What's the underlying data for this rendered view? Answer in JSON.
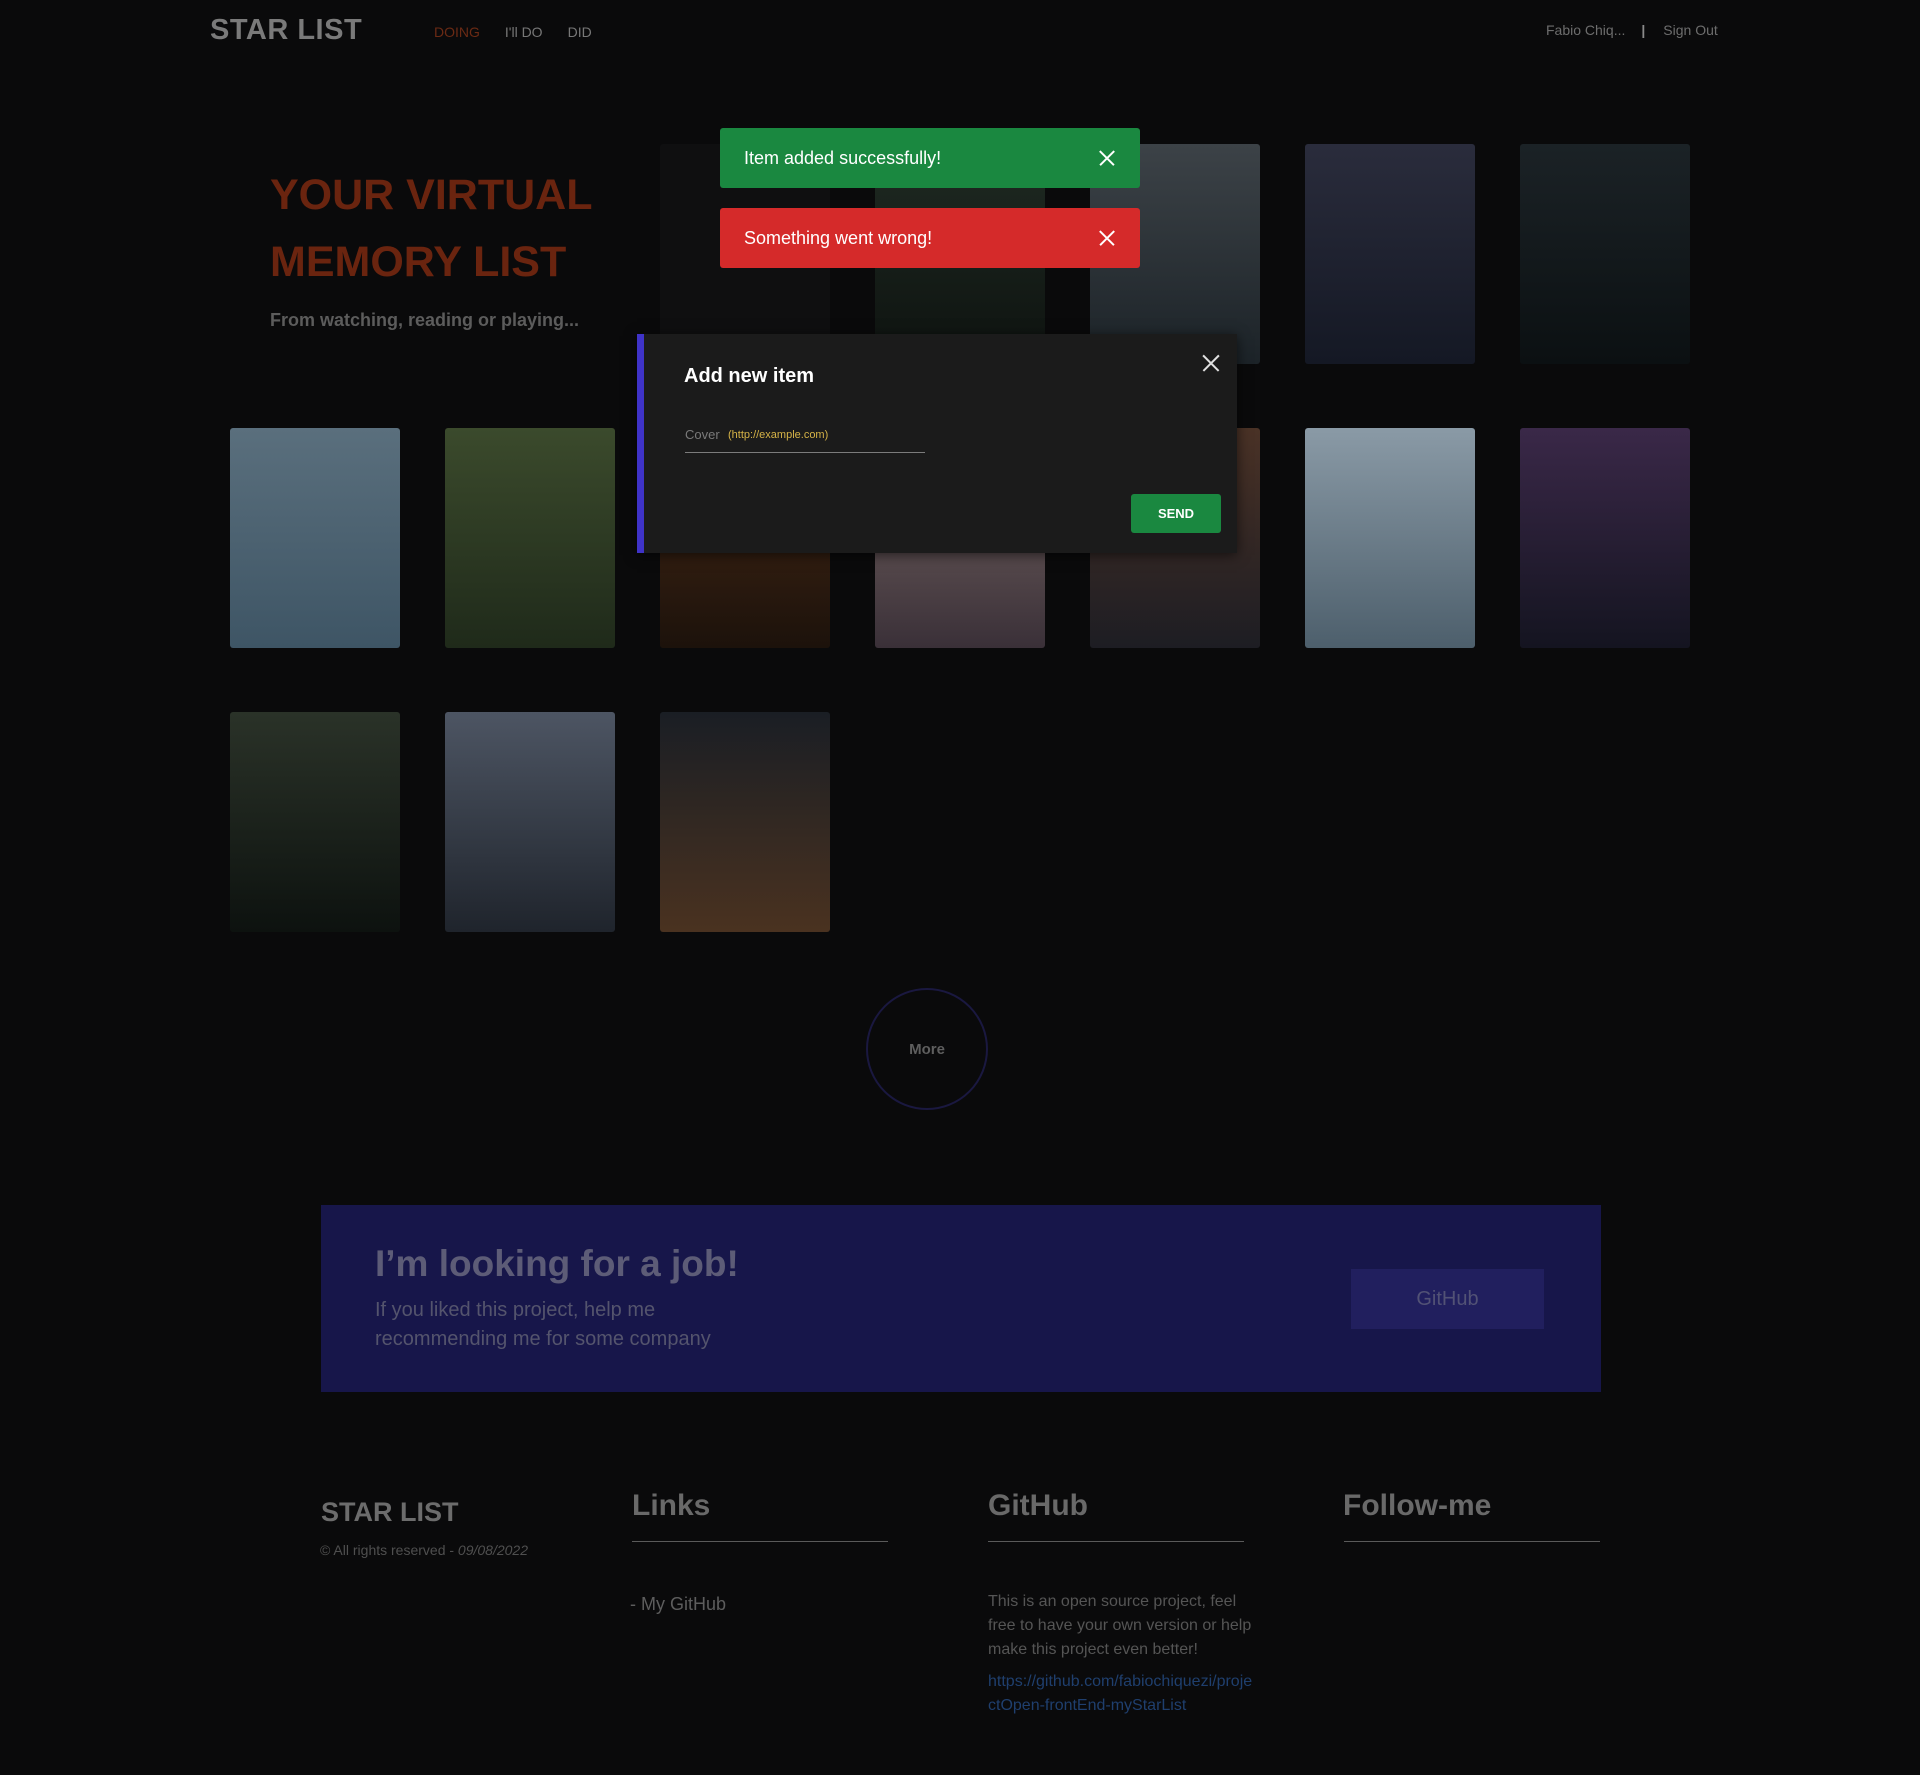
{
  "header": {
    "logo": "STAR LIST",
    "nav": [
      {
        "label": "DOING",
        "active": true
      },
      {
        "label": "I'll DO",
        "active": false
      },
      {
        "label": "DID",
        "active": false
      }
    ],
    "user_name": "Fabio Chiq...",
    "separator": "|",
    "sign_out": "Sign Out"
  },
  "hero": {
    "title": "YOUR VIRTUAL MEMORY LIST",
    "subtitle": "From watching, reading or playing..."
  },
  "gallery": {
    "items": [
      {
        "name": "dark-plants-bridge",
        "colors": [
          "#1f2a22",
          "#0e1310"
        ]
      },
      {
        "name": "misty-lake-mountain",
        "colors": [
          "#3c4247",
          "#1c2328"
        ]
      },
      {
        "name": "milky-way-mountains",
        "colors": [
          "#2a2c3c",
          "#141824"
        ]
      },
      {
        "name": "city-street-night",
        "colors": [
          "#1b2226",
          "#0b1012"
        ]
      },
      {
        "name": "misty-blue-mountains",
        "colors": [
          "#5a6f7d",
          "#3e5565"
        ]
      },
      {
        "name": "viaduct-train",
        "colors": [
          "#3b4a2c",
          "#1f2a1a"
        ]
      },
      {
        "name": "desert-dunes",
        "colors": [
          "#4a2a16",
          "#1c120b"
        ]
      },
      {
        "name": "abstract-swirl",
        "colors": [
          "#7b6a66",
          "#3a3038"
        ]
      },
      {
        "name": "red-cliffs",
        "colors": [
          "#4a3226",
          "#1d1d23"
        ]
      },
      {
        "name": "mountain-lake-reflection",
        "colors": [
          "#8a9aa6",
          "#4d5f6c"
        ]
      },
      {
        "name": "purple-night-sky",
        "colors": [
          "#3a2848",
          "#141420"
        ]
      },
      {
        "name": "lake-village-night",
        "colors": [
          "#2a3228",
          "#0d120f"
        ]
      },
      {
        "name": "grey-peaks",
        "colors": [
          "#4d5563",
          "#1f242c"
        ]
      },
      {
        "name": "dark-hill-stars",
        "colors": [
          "#1a1e24",
          "#4a3220"
        ]
      }
    ]
  },
  "more_label": "More",
  "job": {
    "title": "I’m looking for a job!",
    "subtitle": "If you liked this project, help me recommending me for some company",
    "button": "GitHub"
  },
  "footer": {
    "logo": "STAR LIST",
    "copyright": "© All rights reserved - ",
    "date": "09/08/2022",
    "links_title": "Links",
    "links": [
      "- My GitHub"
    ],
    "github_title": "GitHub",
    "github_text": "This is an open source project, feel free to have your own version or help make this project even better!",
    "github_url": "https://github.com/fabiochiquezi/projectOpen-frontEnd-myStarList",
    "follow_title": "Follow-me"
  },
  "toasts": {
    "success": "Item added successfully!",
    "error": "Something went wrong!"
  },
  "modal": {
    "title": "Add new item",
    "field_label": "Cover",
    "field_placeholder": "(http://example.com)",
    "field_value": "",
    "send": "SEND"
  },
  "colors": {
    "accent": "#3f33c8",
    "success": "#1a8840",
    "error": "#d52a2a"
  }
}
